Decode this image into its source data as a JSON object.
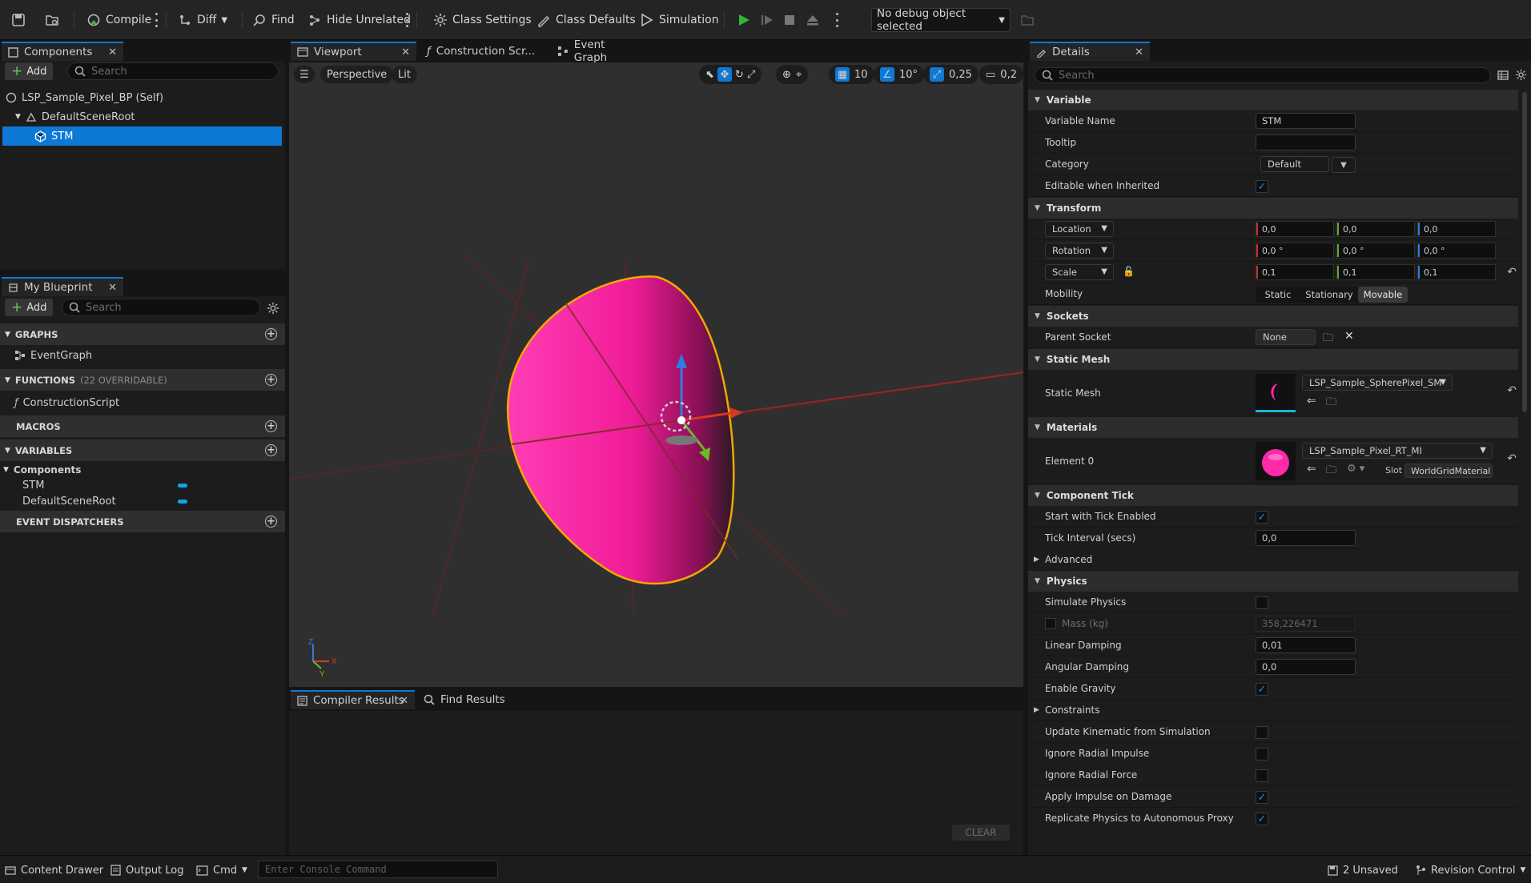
{
  "toolbar": {
    "compile": "Compile",
    "diff": "Diff",
    "find": "Find",
    "hide_unrelated": "Hide Unrelated",
    "class_settings": "Class Settings",
    "class_defaults": "Class Defaults",
    "simulation": "Simulation",
    "debug_object": "No debug object selected"
  },
  "components_panel": {
    "tab": "Components",
    "add": "Add",
    "search_placeholder": "Search",
    "tree": [
      {
        "label": "LSP_Sample_Pixel_BP (Self)"
      },
      {
        "label": "DefaultSceneRoot"
      },
      {
        "label": "STM",
        "selected": true
      }
    ]
  },
  "my_blueprint": {
    "tab": "My Blueprint",
    "add": "Add",
    "search_placeholder": "Search",
    "graphs": "GRAPHS",
    "graph_items": [
      "EventGraph"
    ],
    "functions": "FUNCTIONS",
    "functions_note": "(22 OVERRIDABLE)",
    "function_items": [
      "ConstructionScript"
    ],
    "macros": "MACROS",
    "variables": "VARIABLES",
    "components_group": "Components",
    "variable_items": [
      "STM",
      "DefaultSceneRoot"
    ],
    "event_dispatchers": "EVENT DISPATCHERS"
  },
  "center_tabs": [
    "Viewport",
    "Construction Scr...",
    "Event Graph"
  ],
  "viewport": {
    "view_mode": "Perspective",
    "lighting": "Lit",
    "grid_snap": "10",
    "rotation_snap": "10°",
    "scale_snap": "0,25",
    "camera_speed": "0,2"
  },
  "results": {
    "tabs": [
      "Compiler Results",
      "Find Results"
    ],
    "clear": "CLEAR"
  },
  "details": {
    "tab": "Details",
    "search_placeholder": "Search",
    "variable": {
      "header": "Variable",
      "name_label": "Variable Name",
      "name_value": "STM",
      "tooltip_label": "Tooltip",
      "tooltip_value": "",
      "category_label": "Category",
      "category_value": "Default",
      "editable_label": "Editable when Inherited",
      "editable_checked": true
    },
    "transform": {
      "header": "Transform",
      "location_label": "Location",
      "location": [
        "0,0",
        "0,0",
        "0,0"
      ],
      "rotation_label": "Rotation",
      "rotation": [
        "0,0 °",
        "0,0 °",
        "0,0 °"
      ],
      "scale_label": "Scale",
      "scale": [
        "0,1",
        "0,1",
        "0,1"
      ],
      "mobility_label": "Mobility",
      "mobility_options": [
        "Static",
        "Stationary",
        "Movable"
      ],
      "mobility_selected": "Movable"
    },
    "sockets": {
      "header": "Sockets",
      "parent_label": "Parent Socket",
      "parent_value": "None"
    },
    "static_mesh": {
      "header": "Static Mesh",
      "label": "Static Mesh",
      "value": "LSP_Sample_SpherePixel_SM"
    },
    "materials": {
      "header": "Materials",
      "label": "Element 0",
      "value": "LSP_Sample_Pixel_RT_MI",
      "slot_label": "Slot",
      "slot_value": "WorldGridMaterial"
    },
    "component_tick": {
      "header": "Component Tick",
      "start_label": "Start with Tick Enabled",
      "start_checked": true,
      "interval_label": "Tick Interval (secs)",
      "interval_value": "0,0",
      "advanced": "Advanced"
    },
    "physics": {
      "header": "Physics",
      "simulate_label": "Simulate Physics",
      "simulate_checked": false,
      "mass_label": "Mass (kg)",
      "mass_value": "358,226471",
      "linear_label": "Linear Damping",
      "linear_value": "0,01",
      "angular_label": "Angular Damping",
      "angular_value": "0,0",
      "gravity_label": "Enable Gravity",
      "gravity_checked": true,
      "constraints": "Constraints",
      "kinematic_label": "Update Kinematic from Simulation",
      "kinematic_checked": false,
      "radial_impulse_label": "Ignore Radial Impulse",
      "radial_impulse_checked": false,
      "radial_force_label": "Ignore Radial Force",
      "radial_force_checked": false,
      "impulse_damage_label": "Apply Impulse on Damage",
      "impulse_damage_checked": true,
      "replicate_label": "Replicate Physics to Autonomous Proxy",
      "replicate_checked": true
    }
  },
  "status_bar": {
    "content_drawer": "Content Drawer",
    "output_log": "Output Log",
    "cmd": "Cmd",
    "console_placeholder": "Enter Console Command",
    "unsaved": "2 Unsaved",
    "revision_control": "Revision Control"
  },
  "colors": {
    "accent": "#0e78d5",
    "selection": "#0e78d5",
    "mesh": "#ff2aa8",
    "outline": "#f0a800",
    "checkbox": "#1a8cf0",
    "play": "#35b335"
  }
}
